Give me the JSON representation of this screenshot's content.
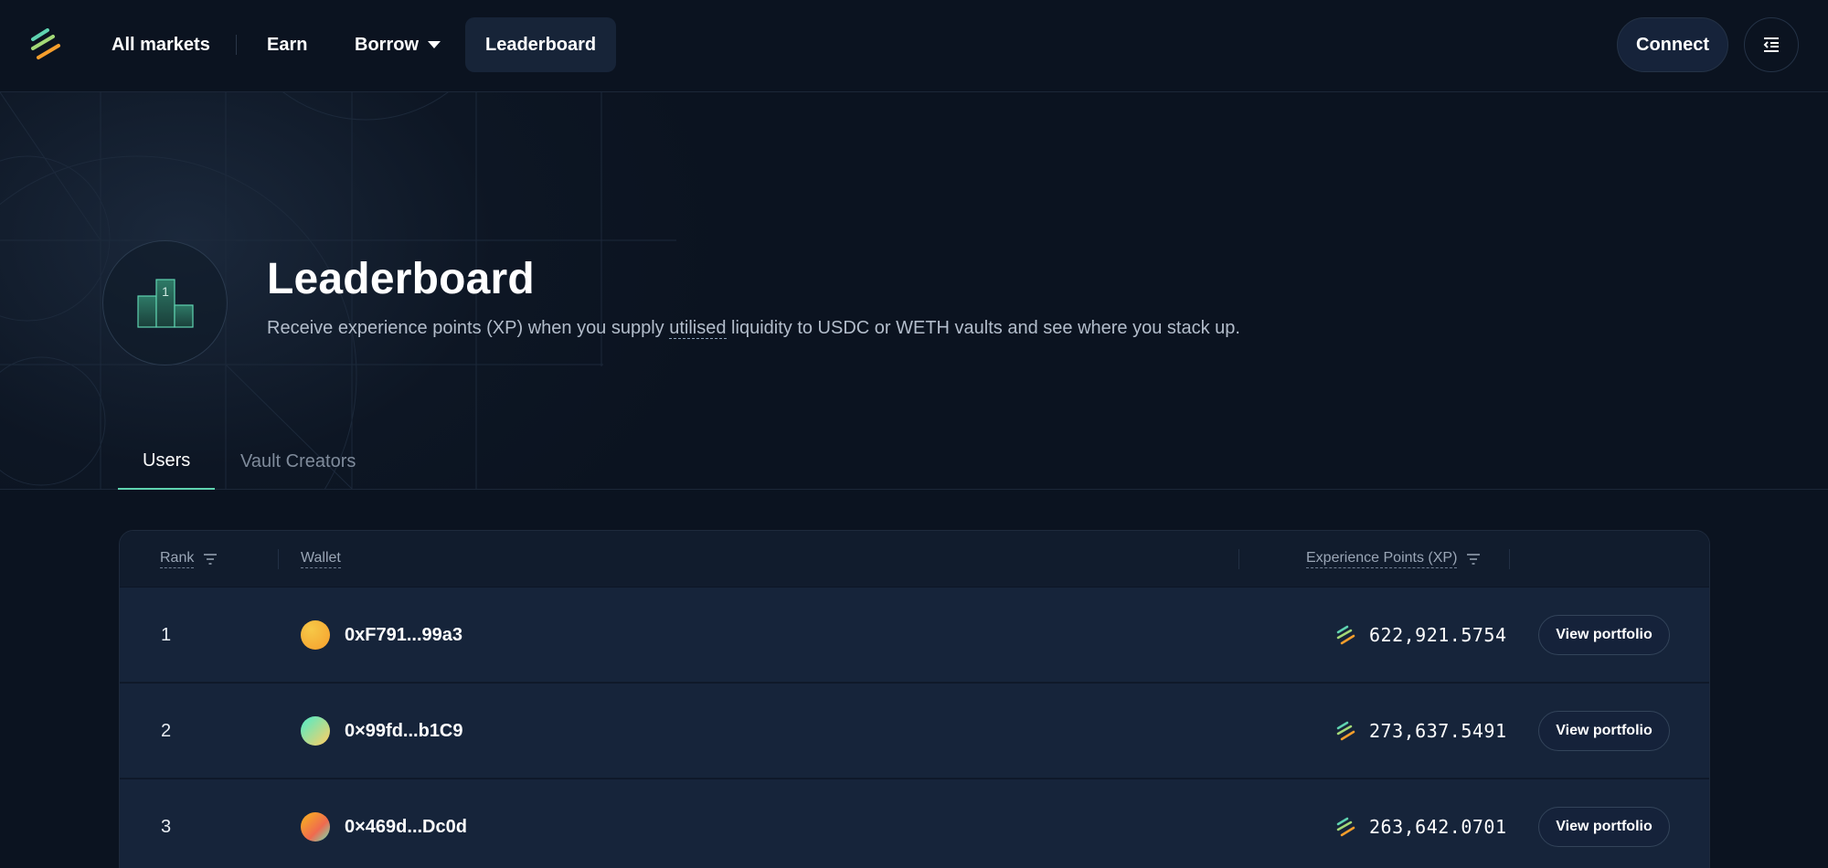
{
  "nav": {
    "links": [
      "All markets",
      "Earn",
      "Borrow",
      "Leaderboard"
    ],
    "active": "Leaderboard",
    "connect_label": "Connect"
  },
  "hero": {
    "trophy_number": "1",
    "title": "Leaderboard",
    "subtitle_before": "Receive experience points (XP) when you supply ",
    "subtitle_highlight": "utilised",
    "subtitle_after": " liquidity to USDC or WETH vaults and see where you stack up."
  },
  "tabs": [
    {
      "label": "Users",
      "active": true
    },
    {
      "label": "Vault Creators",
      "active": false
    }
  ],
  "table": {
    "columns": {
      "rank": "Rank",
      "wallet": "Wallet",
      "xp": "Experience Points (XP)"
    },
    "rows": [
      {
        "rank": "1",
        "wallet": "0xF791...99a3",
        "xp": "622,921.5754",
        "action": "View portfolio",
        "avatar_colors": [
          "#f7c948",
          "#f59e2c"
        ]
      },
      {
        "rank": "2",
        "wallet": "0×99fd...b1C9",
        "xp": "273,637.5491",
        "action": "View portfolio",
        "avatar_colors": [
          "#6ee7b7",
          "#f2d16b"
        ]
      },
      {
        "rank": "3",
        "wallet": "0×469d...Dc0d",
        "xp": "263,642.0701",
        "action": "View portfolio",
        "avatar_colors": [
          "#f59e2c",
          "#ef6a4f"
        ]
      }
    ]
  },
  "colors": {
    "background": "#0b1320",
    "row_bg": "#16243a",
    "accent_green": "#5fd3b0",
    "accent_orange": "#f59e2c"
  }
}
